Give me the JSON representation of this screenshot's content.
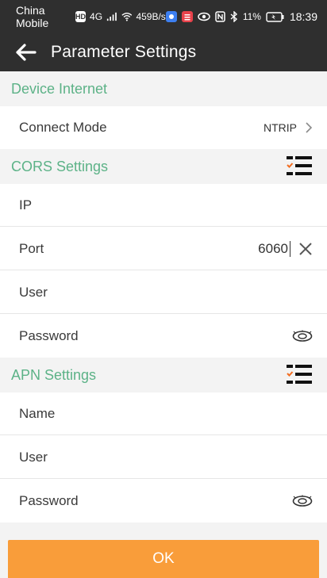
{
  "status_bar": {
    "carrier": "China Mobile",
    "hd_badge": "HD",
    "network": "4G",
    "speed": "459B/s",
    "battery": "11%",
    "time": "18:39"
  },
  "app_bar": {
    "title": "Parameter Settings",
    "back_icon": "arrow-left-icon"
  },
  "device_internet": {
    "header": "Device Internet",
    "connect_mode": {
      "label": "Connect Mode",
      "value": "NTRIP",
      "icon": "chevron-right-icon"
    }
  },
  "cors_settings": {
    "header": "CORS Settings",
    "icon": "list-settings-icon",
    "ip": {
      "label": "IP",
      "value": ""
    },
    "port": {
      "label": "Port",
      "value": "6060",
      "clear_icon": "clear-icon"
    },
    "user": {
      "label": "User",
      "value": ""
    },
    "password": {
      "label": "Password",
      "value": "",
      "toggle_icon": "eye-icon"
    }
  },
  "apn_settings": {
    "header": "APN Settings",
    "icon": "list-settings-icon",
    "name": {
      "label": "Name",
      "value": ""
    },
    "user": {
      "label": "User",
      "value": ""
    },
    "password": {
      "label": "Password",
      "value": "",
      "toggle_icon": "eye-icon"
    }
  },
  "colors": {
    "accent_green": "#5cb287",
    "ok_orange": "#f99d3a",
    "bar_dark": "#2f2f2f"
  },
  "ok_button": {
    "label": "OK"
  }
}
